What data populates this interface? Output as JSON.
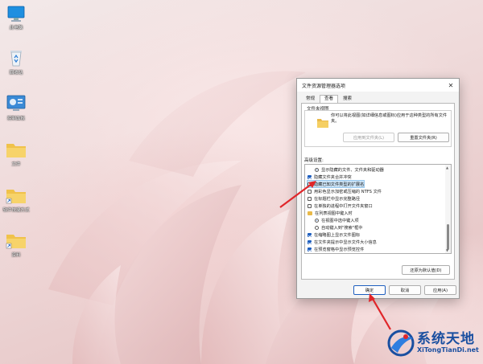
{
  "desktop": {
    "icons": [
      {
        "name": "此电脑",
        "icon": "monitor-icon"
      },
      {
        "name": "回收站",
        "icon": "recycle-bin-icon"
      },
      {
        "name": "控制面板",
        "icon": "control-panel-icon"
      },
      {
        "name": "文件",
        "icon": "folder-icon"
      },
      {
        "name": "软件快捷方式",
        "icon": "folder-shortcut-icon"
      },
      {
        "name": "资料",
        "icon": "folder-icon"
      }
    ]
  },
  "dialog": {
    "title": "文件资源管理器选项",
    "close_glyph": "✕",
    "tabs": [
      {
        "label": "常规",
        "active": false
      },
      {
        "label": "查看",
        "active": true
      },
      {
        "label": "搜索",
        "active": false
      }
    ],
    "folder_views": {
      "label": "文件夹视图",
      "description": "你可以将此视图(如详细信息或图标)应用于这种类型的所有文件夹。",
      "apply_button": "应用到文件夹(L)",
      "reset_button": "重置文件夹(R)"
    },
    "advanced": {
      "label": "高级设置:",
      "items": [
        {
          "type": "radio",
          "checked": true,
          "label": "显示隐藏的文件、文件夹和驱动器",
          "indent": 1
        },
        {
          "type": "checkbox",
          "checked": true,
          "label": "隐藏文件夹合并冲突",
          "indent": 0
        },
        {
          "type": "checkbox",
          "checked": false,
          "label": "隐藏已知文件类型的扩展名",
          "indent": 0,
          "highlighted": true
        },
        {
          "type": "checkbox",
          "checked": false,
          "label": "用彩色显示加密或压缩的 NTFS 文件",
          "indent": 0
        },
        {
          "type": "checkbox",
          "checked": false,
          "label": "在标题栏中显示完整路径",
          "indent": 0
        },
        {
          "type": "checkbox",
          "checked": false,
          "label": "在单独的进程中打开文件夹窗口",
          "indent": 0
        },
        {
          "type": "folder",
          "checked": false,
          "label": "在列表视图中键入时",
          "indent": 0
        },
        {
          "type": "radio",
          "checked": true,
          "label": "在视图中选中键入项",
          "indent": 1
        },
        {
          "type": "radio",
          "checked": false,
          "label": "自动键入到\"搜索\"框中",
          "indent": 1
        },
        {
          "type": "checkbox",
          "checked": true,
          "label": "在缩略图上显示文件图标",
          "indent": 0
        },
        {
          "type": "checkbox",
          "checked": true,
          "label": "在文件夹提示中显示文件大小信息",
          "indent": 0
        },
        {
          "type": "checkbox",
          "checked": true,
          "label": "在预览窗格中显示预览控件",
          "indent": 0
        }
      ],
      "restore_button": "还原为默认值(D)"
    },
    "footer": {
      "ok": "确定",
      "cancel": "取消",
      "apply": "应用(A)"
    }
  },
  "watermark": {
    "title": "系统天地",
    "subtitle": "XiTongTianDi.net"
  },
  "colors": {
    "accent": "#1f5fbf",
    "annotation_arrow": "#e0262a",
    "watermark": "#1a4fa0"
  }
}
